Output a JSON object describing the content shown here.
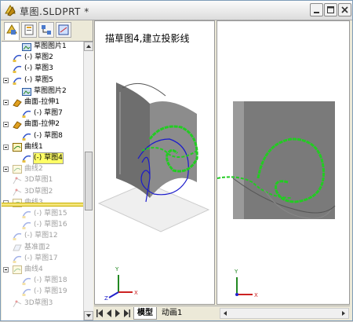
{
  "window": {
    "title": "草图.SLDPRT *"
  },
  "left_tabs": [
    "feature-manager",
    "property-manager",
    "configuration-manager",
    "dimxpert-manager"
  ],
  "tree": [
    {
      "label": "草图图片1",
      "icon": "sketch-picture-icon",
      "indent": 2,
      "gray": false
    },
    {
      "label": "(-) 草图2",
      "icon": "sketch-icon",
      "indent": 1,
      "gray": false
    },
    {
      "label": "(-) 草图3",
      "icon": "sketch-icon",
      "indent": 1,
      "gray": false
    },
    {
      "label": "(-) 草图5",
      "icon": "sketch-icon",
      "indent": 1,
      "gray": false,
      "expander": true
    },
    {
      "label": "草图图片2",
      "icon": "sketch-picture-icon",
      "indent": 2,
      "gray": false
    },
    {
      "label": "曲面-拉伸1",
      "icon": "surface-extrude-icon",
      "indent": 1,
      "gray": false,
      "expander": true
    },
    {
      "label": "(-) 草图7",
      "icon": "sketch-icon",
      "indent": 2,
      "gray": false
    },
    {
      "label": "曲面-拉伸2",
      "icon": "surface-extrude-icon",
      "indent": 1,
      "gray": false,
      "expander": true
    },
    {
      "label": "(-) 草图8",
      "icon": "sketch-icon",
      "indent": 2,
      "gray": false
    },
    {
      "label": "曲线1",
      "icon": "curve-icon",
      "indent": 1,
      "gray": false,
      "expander": true
    },
    {
      "label": "(-) 草图4",
      "icon": "sketch-icon",
      "indent": 2,
      "gray": false,
      "selected": true
    },
    {
      "label": "曲线2",
      "icon": "curve-icon",
      "indent": 1,
      "gray": true,
      "expander": true
    },
    {
      "label": "3D草图1",
      "icon": "3d-sketch-icon",
      "indent": 1,
      "gray": true
    },
    {
      "label": "3D草图2",
      "icon": "3d-sketch-icon",
      "indent": 1,
      "gray": true
    },
    {
      "label": "曲线3",
      "icon": "curve-icon",
      "indent": 1,
      "gray": true,
      "expander": true
    },
    {
      "label": "(-) 草图15",
      "icon": "sketch-icon",
      "indent": 2,
      "gray": true
    },
    {
      "label": "(-) 草图16",
      "icon": "sketch-icon",
      "indent": 2,
      "gray": true
    },
    {
      "label": "(-) 草图12",
      "icon": "sketch-icon",
      "indent": 1,
      "gray": true
    },
    {
      "label": "基准面2",
      "icon": "plane-icon",
      "indent": 1,
      "gray": true
    },
    {
      "label": "(-) 草图17",
      "icon": "sketch-icon",
      "indent": 1,
      "gray": true
    },
    {
      "label": "曲线4",
      "icon": "curve-icon",
      "indent": 1,
      "gray": true,
      "expander": true
    },
    {
      "label": "(-) 草图18",
      "icon": "sketch-icon",
      "indent": 2,
      "gray": true
    },
    {
      "label": "(-) 草图19",
      "icon": "sketch-icon",
      "indent": 2,
      "gray": true
    },
    {
      "label": "3D草图3",
      "icon": "3d-sketch-icon",
      "indent": 1,
      "gray": true
    }
  ],
  "viewport": {
    "label": "描草图4,建立投影线"
  },
  "bottom_tabs": [
    {
      "label": "模型",
      "active": true
    },
    {
      "label": "动画1",
      "active": false
    }
  ],
  "colors": {
    "curve_green": "#22cc22",
    "curve_blue": "#1a1acc",
    "surface_gray": "#7a7a7a",
    "selection": "#ffff66"
  }
}
